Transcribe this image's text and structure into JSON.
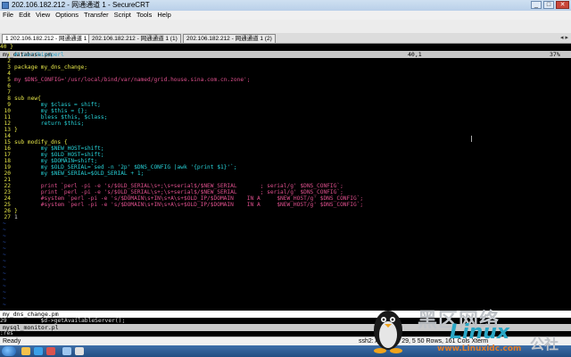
{
  "window": {
    "title": "202.106.182.212 - 网通通道 1 - SecureCRT",
    "buttons": {
      "minimize": "_",
      "maximize": "□",
      "close": "✕"
    }
  },
  "menu": [
    "File",
    "Edit",
    "View",
    "Options",
    "Transfer",
    "Script",
    "Tools",
    "Help"
  ],
  "tabs": [
    {
      "label": "1 202.106.182.212 - 网通通道 1",
      "active": true
    },
    {
      "label": "202.106.182.212 - 网通通道 1 (1)",
      "active": false
    },
    {
      "label": "202.106.182.212 - 网通通道 1 (2)",
      "active": false
    }
  ],
  "tab_scroll": "◂ ▸",
  "top_pane": {
    "line40": "40 }",
    "file_name": "my_database.pm",
    "position": "40,1",
    "percent": "37%"
  },
  "code": [
    {
      "n": "1",
      "text": "#!/usr/bin/perl",
      "cls": "cmt"
    },
    {
      "n": "2",
      "text": ""
    },
    {
      "n": "3",
      "text": "package my_dns_change;",
      "cls": "kw"
    },
    {
      "n": "4",
      "text": ""
    },
    {
      "n": "5",
      "text": "my $DNS_CONFIG='/usr/local/bind/var/named/grid.house.sina.com.cn.zone';",
      "cls": "str"
    },
    {
      "n": "6",
      "text": ""
    },
    {
      "n": "7",
      "text": ""
    },
    {
      "n": "8",
      "text": "sub new{",
      "cls": "kw"
    },
    {
      "n": "9",
      "text": "        my $class = shift;",
      "cls": "var"
    },
    {
      "n": "10",
      "text": "        my $this = {};",
      "cls": "var"
    },
    {
      "n": "11",
      "text": "        bless $this, $class;",
      "cls": "var"
    },
    {
      "n": "12",
      "text": "        return $this;",
      "cls": "var"
    },
    {
      "n": "13",
      "text": "}",
      "cls": "kw"
    },
    {
      "n": "14",
      "text": ""
    },
    {
      "n": "15",
      "text": "sub modify_dns {",
      "cls": "kw"
    },
    {
      "n": "16",
      "text": "        my $NEW_HOST=shift;",
      "cls": "var"
    },
    {
      "n": "17",
      "text": "        my $OLD_HOST=shift;",
      "cls": "var"
    },
    {
      "n": "18",
      "text": "        my $DOMAIN=shift;",
      "cls": "var"
    },
    {
      "n": "19",
      "text": "        my $OLD_SERIAL=`sed -n '2p' $DNS_CONFIG |awk '{print $1}'`;",
      "cls": "var"
    },
    {
      "n": "20",
      "text": "        my $NEW_SERIAL=$OLD_SERIAL + 1;",
      "cls": "var"
    },
    {
      "n": "21",
      "text": ""
    },
    {
      "n": "22",
      "text": "        print `perl -pi -e 's/$OLD_SERIAL\\s+;\\s+serial$/$NEW_SERIAL       ; serial/g' $DNS_CONFIG`;",
      "cls": "str"
    },
    {
      "n": "23",
      "text": "        print `perl -pi -e 's/$OLD_SERIAL\\s+;\\s+serial$/$NEW_SERIAL       ; serial/g' $DNS_CONFIG`;",
      "cls": "str"
    },
    {
      "n": "24",
      "text": "        #system `perl -pi -e 's/$DOMAIN\\s+IN\\s+A\\s+$OLD_IP/$DOMAIN    IN A     $NEW_HOST/g' $DNS_CONFIG`;",
      "cls": "str"
    },
    {
      "n": "25",
      "text": "        #system `perl -pi -e 's/$DOMAIN\\s+IN\\s+A\\s+$OLD_IP/$DOMAIN    IN A     $NEW_HOST/g' $DNS_CONFIG`;",
      "cls": "str"
    },
    {
      "n": "26",
      "text": "}",
      "cls": "kw"
    },
    {
      "n": "27",
      "text": "1",
      "cls": ""
    }
  ],
  "bottom_pane": {
    "file_name": "my_dns_change.pm",
    "line29": "29          $d->getAvailableServer();",
    "file2": "mysql_monitor.pl",
    "cmd": ":res"
  },
  "status": {
    "ready": "Ready",
    "info": "ssh2: AES-256  29,  5  50 Rows, 161 Cols  Xterm"
  },
  "watermark": {
    "cn": "黑区网络",
    "linux": "Linux",
    "she": "公社",
    "site": "www.Linuxidc.com"
  }
}
